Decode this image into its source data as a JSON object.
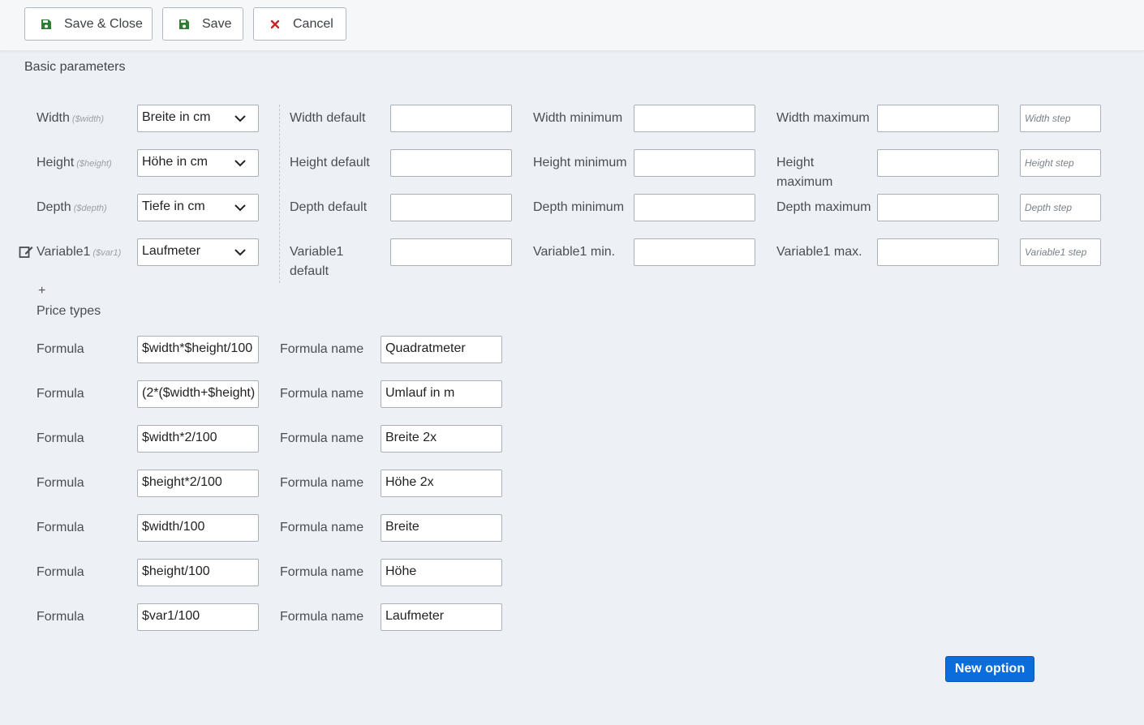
{
  "toolbar": {
    "save_close_label": "Save & Close",
    "save_label": "Save",
    "cancel_label": "Cancel"
  },
  "section": {
    "basic_parameters": "Basic parameters"
  },
  "parameters": [
    {
      "label": "Width",
      "var": "($width)",
      "select_value": "Breite in cm",
      "default_label": "Width default",
      "min_label": "Width minimum",
      "max_label": "Width maximum",
      "step_placeholder": "Width step"
    },
    {
      "label": "Height",
      "var": "($height)",
      "select_value": "Höhe in cm",
      "default_label": "Height default",
      "min_label": "Height minimum",
      "max_label_line1": "Height",
      "max_label_line2": "maximum",
      "step_placeholder": "Height step"
    },
    {
      "label": "Depth",
      "var": "($depth)",
      "select_value": "Tiefe in cm",
      "default_label": "Depth default",
      "min_label": "Depth minimum",
      "max_label": "Depth maximum",
      "step_placeholder": "Depth step"
    },
    {
      "label": "Variable1",
      "var": "($var1)",
      "select_value": "Laufmeter",
      "default_label_line1": "Variable1",
      "default_label_line2": "default",
      "min_label": "Variable1 min.",
      "max_label": "Variable1 max.",
      "step_placeholder": "Variable1 step"
    }
  ],
  "add_symbol": "+",
  "price_types_label": "Price types",
  "formula_label": "Formula",
  "formula_name_label": "Formula name",
  "formulas": [
    {
      "formula": "$width*$height/100",
      "name": "Quadratmeter"
    },
    {
      "formula": "(2*($width+$height)",
      "name": "Umlauf in m"
    },
    {
      "formula": "$width*2/100",
      "name": "Breite 2x"
    },
    {
      "formula": "$height*2/100",
      "name": "Höhe 2x"
    },
    {
      "formula": "$width/100",
      "name": "Breite"
    },
    {
      "formula": "$height/100",
      "name": "Höhe"
    },
    {
      "formula": "$var1/100",
      "name": "Laufmeter"
    }
  ],
  "new_option_label": "New option",
  "colors": {
    "accent": "#0a6ddb",
    "save_icon": "#2f7d32",
    "cancel_icon": "#c62828"
  }
}
